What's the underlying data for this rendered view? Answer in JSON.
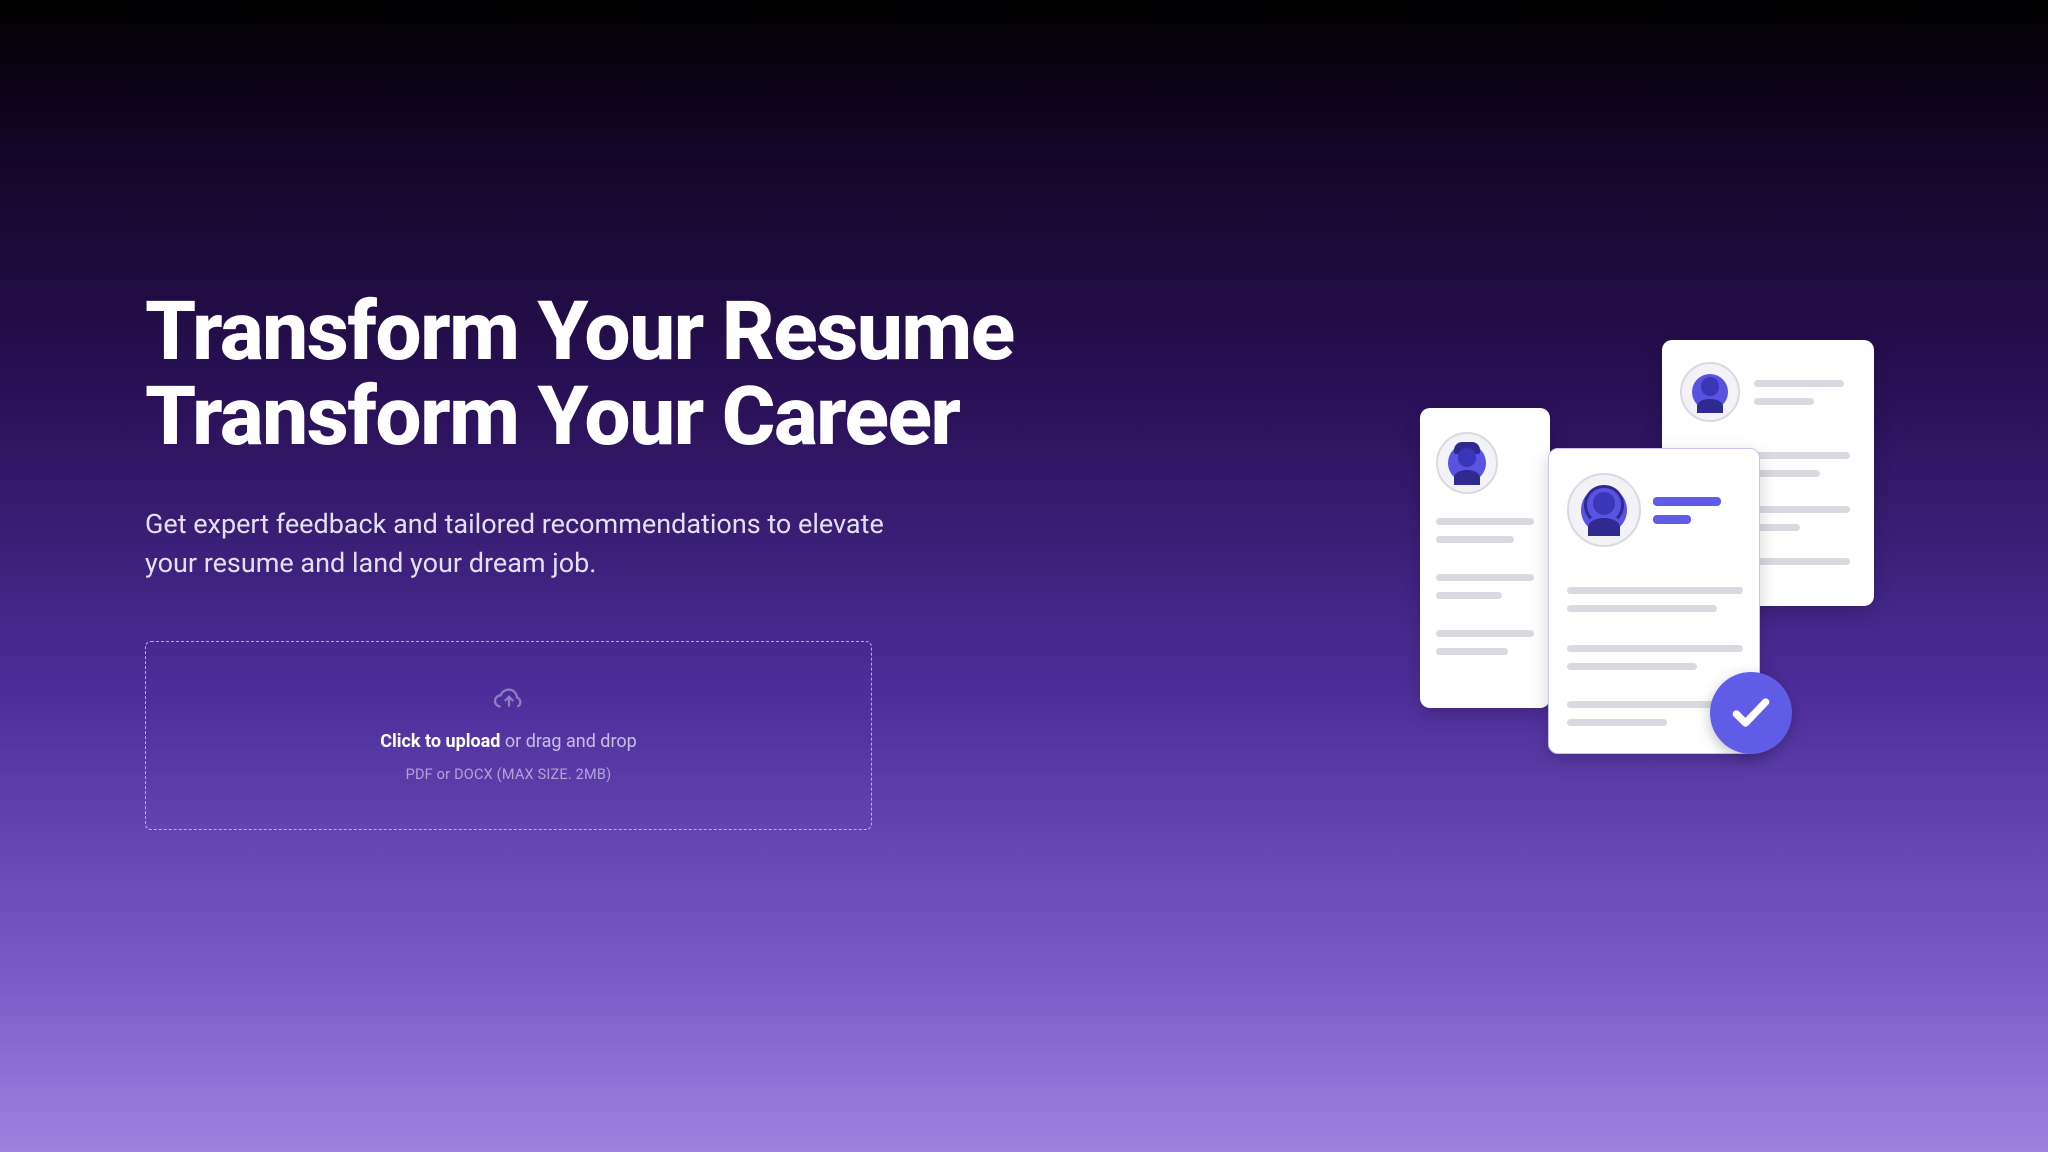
{
  "hero": {
    "headline_l1": "Transform Your Resume",
    "headline_l2": "Transform Your Career",
    "subhead": "Get expert feedback and tailored recommendations to elevate your resume and land your dream job."
  },
  "upload": {
    "click": "Click to upload",
    "drag": " or drag and drop",
    "hint": "PDF or DOCX (MAX SIZE. 2MB)"
  },
  "colors": {
    "accent": "#5f5ce8"
  }
}
